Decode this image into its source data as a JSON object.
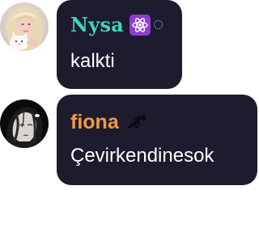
{
  "messages": [
    {
      "author": "Nysa",
      "author_color": "#3fd5b6",
      "badge_icon": "atom-icon",
      "badge_color": "#8d3fd1",
      "text": "kalkti"
    },
    {
      "author": "fiona",
      "author_color": "#f39a3c",
      "badge_icon": "rifle-icon",
      "text": "Çevirkendinesok"
    }
  ],
  "colors": {
    "bubble_background": "#1f1b2e",
    "message_text": "#ffffff",
    "page_background": "#ffffff"
  }
}
